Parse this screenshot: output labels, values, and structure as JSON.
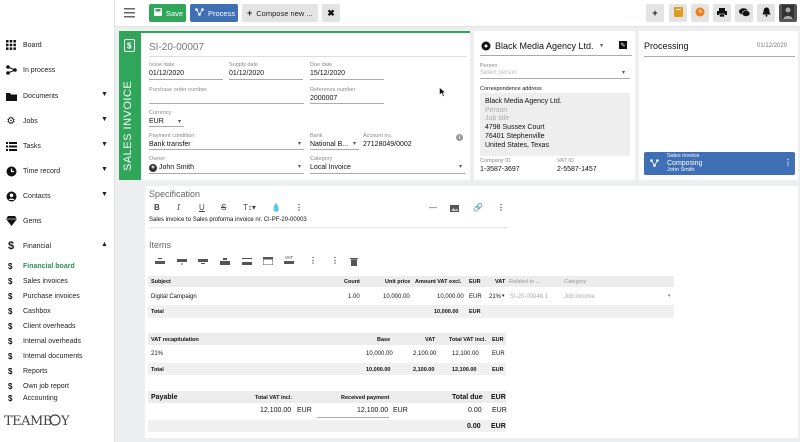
{
  "sidebar": {
    "items": [
      {
        "label": "Board",
        "icon": "grid-icon"
      },
      {
        "label": "In process",
        "icon": "flow-icon"
      },
      {
        "label": "Documents",
        "icon": "folder-icon"
      },
      {
        "label": "Jobs",
        "icon": "gears-icon"
      },
      {
        "label": "Tasks",
        "icon": "tasks-icon"
      },
      {
        "label": "Time record",
        "icon": "clock-icon"
      },
      {
        "label": "Contacts",
        "icon": "contacts-icon"
      },
      {
        "label": "Gems",
        "icon": "gem-icon"
      },
      {
        "label": "Financial",
        "icon": "dollar-icon"
      }
    ],
    "financial_sub": [
      "Financial board",
      "Sales invoices",
      "Purchase invoices",
      "Cashbox",
      "Client overheads",
      "Internal overheads",
      "Internal documents",
      "Reports",
      "Own job report",
      "Accounting"
    ],
    "logo_text": "TEAMBOXY"
  },
  "toolbar": {
    "save_label": "Save",
    "process_label": "Process",
    "compose_label": "Compose new ...",
    "colors": {
      "save": "#2fa65a",
      "process": "#3f6fb5",
      "compose": "#e3e3e3"
    }
  },
  "invoice": {
    "vertical_title": "SALES INVOICE",
    "number": "SI-20-00007",
    "issue_date_label": "Issue date",
    "issue_date": "01/12/2020",
    "supply_date_label": "Supply date",
    "supply_date": "01/12/2020",
    "due_date_label": "Due date",
    "due_date": "15/12/2020",
    "po_label": "Purchase order number",
    "po_value": "",
    "reference_label": "Reference number",
    "reference": "2000007",
    "currency_label": "Currency",
    "currency": "EUR",
    "payment_label": "Payment condition",
    "payment": "Bank transfer",
    "bank_label": "Bank",
    "bank": "National B...",
    "account_label": "Account no.",
    "account": "27128049/0002",
    "owner_label": "Owner",
    "owner": "John Smith",
    "category_label": "Category",
    "category": "Local Invoice"
  },
  "client": {
    "name": "Black Media Agency Ltd.",
    "person_label": "Person",
    "person_placeholder": "Select person",
    "corr_label": "Correspondence address",
    "address": [
      "Black Media Agency Ltd.",
      "Person",
      "Job title",
      "4798 Sussex Court",
      "76401 Stephenville",
      "United States, Texas"
    ],
    "company_id_label": "Company ID",
    "company_id": "1-3587-3697",
    "vat_id_label": "VAT ID",
    "vat_id": "2-5587-1457"
  },
  "processing": {
    "title": "Processing",
    "date": "01/12/2020",
    "card_type": "Sales invoice",
    "card_status": "Composing",
    "card_person": "John Smith"
  },
  "spec": {
    "title": "Specification",
    "text": "Sales invoice to Sales proforma invoice nr. CI-PF-20-00003"
  },
  "items": {
    "title": "Items",
    "headers": [
      "Subject",
      "Count",
      "Unit price",
      "Amount VAT excl.",
      "EUR",
      "VAT",
      "Related to ...",
      "Category"
    ],
    "row": {
      "subject": "Digital Campaign",
      "count": "1.00",
      "unit": "10,000.00",
      "amount": "10,000.00",
      "cur": "EUR",
      "vat": "21%",
      "related": "SI-20-00048.1",
      "category": "Job income"
    },
    "total_label": "Total",
    "total_amount": "10,000.00",
    "total_cur": "EUR"
  },
  "vat": {
    "headers": [
      "VAT recapitulation",
      "Base",
      "VAT",
      "Total VAT incl.",
      "EUR"
    ],
    "row": {
      "rate": "21%",
      "base": "10,000.00",
      "vat": "2,100.00",
      "total": "12,100.00",
      "cur": "EUR"
    },
    "total": {
      "label": "Total",
      "base": "10,000.00",
      "vat": "2,100.00",
      "total": "12,100.00",
      "cur": "EUR"
    }
  },
  "payable": {
    "label": "Payable",
    "h_total": "Total VAT incl.",
    "h_received": "Received payment",
    "h_due": "Total due",
    "h_cur": "EUR",
    "total": "12,100.00",
    "total_cur": "EUR",
    "received": "12,100.00",
    "received_cur": "EUR",
    "due": "0.00",
    "due_cur": "EUR",
    "final_due": "0.00",
    "final_cur": "EUR"
  }
}
